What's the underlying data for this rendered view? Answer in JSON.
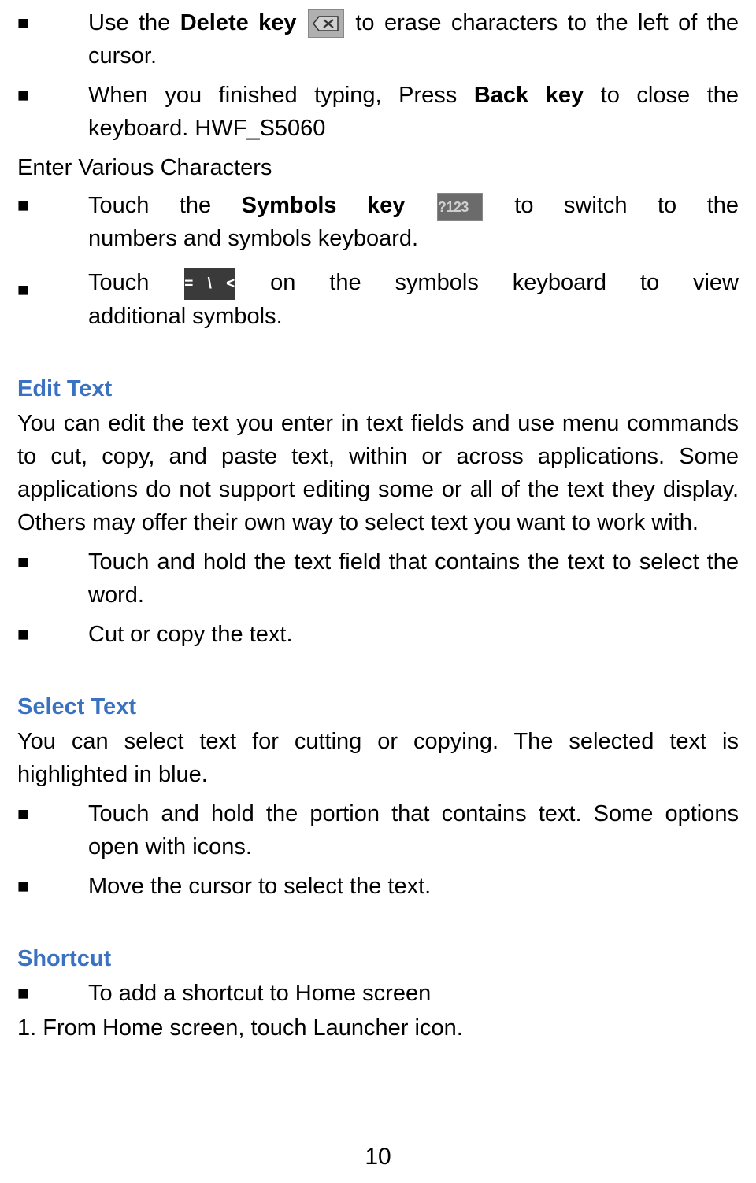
{
  "bullets_top": [
    {
      "pre": "Use the ",
      "bold": "Delete key",
      "icon": "delete",
      "post": " to erase characters to the left of the cursor."
    },
    {
      "pre": "When you finished typing, Press ",
      "bold": "Back key",
      "post": " to close the keyboard. HWF_S5060"
    }
  ],
  "subheading_1": "Enter Various Characters",
  "bullets_enter": [
    {
      "pre": "Touch the ",
      "bold": "Symbols key",
      "icon": "symbols",
      "icon_label": "?123",
      "post": " to switch to the numbers and symbols keyboard."
    },
    {
      "pre": "Touch ",
      "icon": "extra",
      "icon_label": "= \\ <",
      "post": " on the symbols keyboard to view additional symbols."
    }
  ],
  "heading_edit": "Edit Text",
  "para_edit": "You can edit the text you enter in text fields and use menu commands to cut, copy, and paste text, within or across applications. Some applications do not support editing some or all of the text they display. Others may offer their own way to select text you want to work with.",
  "bullets_edit": [
    "Touch and hold the text field that contains the text to select the word.",
    "Cut or copy the text."
  ],
  "heading_select": "Select Text",
  "para_select": "You can select text for cutting or copying. The selected text is highlighted in blue.",
  "bullets_select": [
    "Touch and hold the portion that contains text. Some options open with icons.",
    "Move the cursor to select the text."
  ],
  "heading_shortcut": "Shortcut",
  "bullets_shortcut": [
    "To add a shortcut to Home screen"
  ],
  "numbered_shortcut": "1. From Home screen, touch Launcher icon.",
  "page_number": "10"
}
